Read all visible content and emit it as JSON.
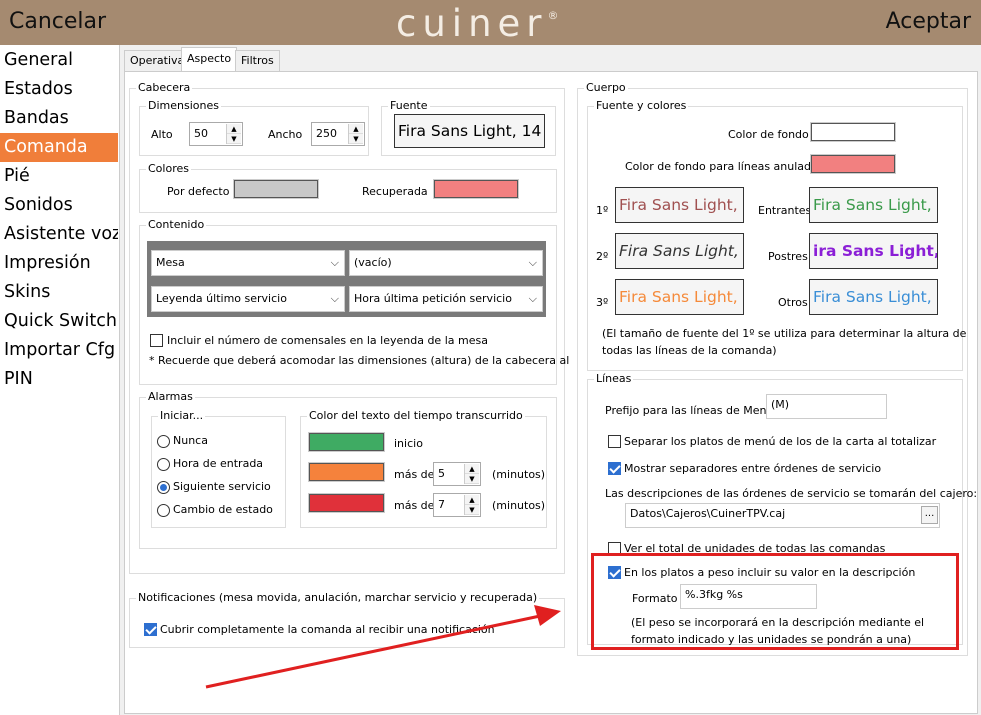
{
  "header": {
    "cancel": "Cancelar",
    "logo": "cuiner",
    "accept": "Aceptar"
  },
  "sidebar": {
    "items": [
      {
        "label": "General"
      },
      {
        "label": "Estados"
      },
      {
        "label": "Bandas"
      },
      {
        "label": "Comanda"
      },
      {
        "label": "Pié"
      },
      {
        "label": "Sonidos"
      },
      {
        "label": "Asistente voz"
      },
      {
        "label": "Impresión"
      },
      {
        "label": "Skins"
      },
      {
        "label": "Quick Switch"
      },
      {
        "label": "Importar Cfg"
      },
      {
        "label": "PIN"
      }
    ],
    "active": "Comanda"
  },
  "tabs": [
    "Operativa",
    "Aspecto",
    "Filtros"
  ],
  "cabecera": {
    "title": "Cabecera",
    "dimensiones": {
      "title": "Dimensiones",
      "alto_label": "Alto",
      "alto": "50",
      "ancho_label": "Ancho",
      "ancho": "250"
    },
    "fuente": {
      "title": "Fuente",
      "value": "Fira Sans Light, 14"
    },
    "colores": {
      "title": "Colores",
      "defecto_label": "Por defecto",
      "defecto_color": "#c8c8c8",
      "recuperada_label": "Recuperada",
      "recuperada_color": "#f28080"
    },
    "contenido": {
      "title": "Contenido",
      "combo1": "Mesa",
      "combo2": "(vacío)",
      "combo3": "Leyenda último servicio",
      "combo4": "Hora última petición servicio",
      "check_label": "Incluir el número de comensales en la leyenda de la mesa",
      "note": "* Recuerde que deberá acomodar las dimensiones (altura) de la cabecera al"
    },
    "alarmas": {
      "title": "Alarmas",
      "iniciar": {
        "title": "Iniciar...",
        "options": [
          "Nunca",
          "Hora de entrada",
          "Siguiente servicio",
          "Cambio de estado"
        ],
        "selected": 2
      },
      "color_tiempo": {
        "title": "Color del texto del tiempo transcurrido",
        "inicio_label": "inicio",
        "inicio_color": "#3fab63",
        "mas_de_label": "más de",
        "minutos_label": "(minutos)",
        "v1": "5",
        "c1": "#f5823c",
        "v2": "7",
        "c2": "#e0313a"
      }
    }
  },
  "notificaciones": {
    "title": "Notificaciones (mesa movida, anulación, marchar servicio y recuperada)",
    "check_label": "Cubrir completamente la comanda al recibir una notificación"
  },
  "cuerpo": {
    "title": "Cuerpo",
    "fuente_colores": {
      "title": "Fuente y colores",
      "color_fondo_label": "Color de fondo",
      "color_fondo": "#ffffff",
      "color_anuladas_label": "Color de fondo para líneas anuladas",
      "color_anuladas": "#f28080",
      "rows": [
        {
          "left_label": "1º",
          "left_font": "Fira Sans Light, 14",
          "left_color": "#a05050",
          "right_label": "Entrantes",
          "right_font": "Fira Sans Light, 14",
          "right_color": "#3a9a4a"
        },
        {
          "left_label": "2º",
          "left_font": "Fira Sans Light, 14",
          "left_color": "#333333",
          "right_label": "Postres",
          "right_font": "ira Sans Light, 1",
          "right_color": "#8b1fd6"
        },
        {
          "left_label": "3º",
          "left_font": "Fira Sans Light, 14",
          "left_color": "#f58a3a",
          "right_label": "Otros",
          "right_font": "Fira Sans Light, 14",
          "right_color": "#3a8ed6"
        }
      ],
      "note1": "(El tamaño de fuente del 1º se utiliza para determinar la altura de",
      "note2": "todas las líneas de la comanda)"
    },
    "lineas": {
      "title": "Líneas",
      "prefijo_label": "Prefijo para las líneas de Menú",
      "prefijo": "(M)",
      "separar_label": "Separar los platos de menú de los de la carta al totalizar",
      "mostrar_label": "Mostrar separadores entre órdenes de servicio",
      "desc_label": "Las descripciones de las órdenes de servicio se tomarán del cajero:",
      "desc_path": "Datos\\Cajeros\\CuinerTPV.caj",
      "browse": "...",
      "total_label": "Ver el total de unidades de todas las comandas",
      "peso_label": "En los platos a peso incluir su valor en la descripción",
      "formato_label": "Formato",
      "formato": "%.3fkg %s",
      "peso_note1": "(El peso se incorporará en la descripción mediante el",
      "peso_note2": "formato indicado y las unidades se pondrán a una)"
    }
  }
}
